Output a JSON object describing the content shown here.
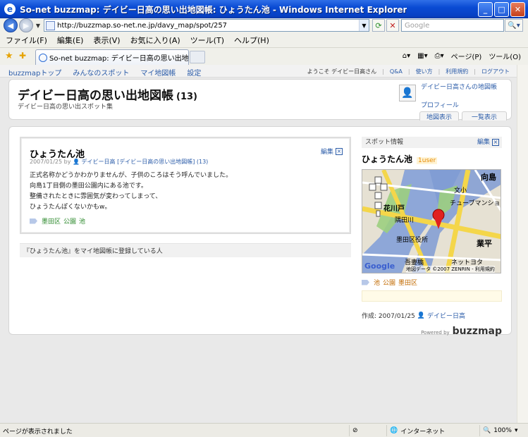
{
  "window": {
    "title": "So-net buzzmap: デイビー日高の思い出地図帳: ひょうたん池 - Windows Internet Explorer",
    "address": "http://buzzmap.so-net.ne.jp/davy_map/spot/257",
    "search_placeholder": "Google",
    "menu": [
      "ファイル(F)",
      "編集(E)",
      "表示(V)",
      "お気に入り(A)",
      "ツール(T)",
      "ヘルプ(H)"
    ],
    "tab_label": "So-net buzzmap: デイビー日高の思い出地図帳: ひょう...",
    "tools": [
      "ページ(P)",
      "ツール(O)"
    ]
  },
  "sitenav": {
    "links": [
      "buzzmapトップ",
      "みんなのスポット",
      "マイ地図帳",
      "設定"
    ],
    "welcome": "ようこそ デイビー日高さん",
    "right_links": [
      "Q&A",
      "使い方",
      "利用規約",
      "ログアウト"
    ]
  },
  "header": {
    "title": "デイビー日高の思い出地図帳",
    "count": "(13)",
    "subtitle": "デイビー日高の思い出スポット集",
    "owner_link": "デイビー日高さんの地図帳",
    "profile": "プロフィール",
    "tab_map": "地図表示",
    "tab_list": "一覧表示"
  },
  "spot": {
    "title": "ひょうたん池",
    "date": "2007/01/25 by",
    "author": "デイビー日高",
    "mapbook": "[デイビー日高の思い出地図帳] (13)",
    "edit": "編集",
    "body": [
      "正式名称かどうかわかりませんが、子供のころはそう呼んでいました。",
      "向島1丁目側の墨田公園内にある池です。",
      "整備されたときに雰囲気が変わってしまって、",
      "ひょうたんぽくないかもw。"
    ],
    "tags": [
      "墨田区",
      "公園",
      "池"
    ]
  },
  "registered_label": "『ひょうたん池』をマイ地図帳に登録している人",
  "sidebar": {
    "heading": "スポット情報",
    "edit": "編集",
    "spot_name": "ひょうたん池",
    "users": "1user",
    "tags": [
      "池",
      "公園",
      "墨田区"
    ],
    "created_label": "作成: 2007/01/25",
    "created_by": "デイビー日高",
    "powered_by": "Powered by",
    "brand": "buzzmap",
    "map_labels": {
      "mukoujima": "向島",
      "bunkyo": "文小",
      "hanakawado": "花川戸",
      "sumida_river": "隅田川",
      "sumida_ward": "墨田区役所",
      "tube_mansion": "チューブマンショ",
      "gyohei": "業平",
      "azumabashi": "吾妻橋",
      "netto": "ネットヨタ",
      "copyright": "地図データ ©2007 ZENRIN - 利用規約",
      "google": "Google"
    }
  },
  "statusbar": {
    "text": "ページが表示されました",
    "zone": "インターネット",
    "zoom": "100%"
  },
  "colors": {
    "link": "#2a5ba8",
    "tag_green": "#2d8a2d",
    "tag_orange": "#c26a00",
    "title_bar": "#0a4bd3"
  }
}
